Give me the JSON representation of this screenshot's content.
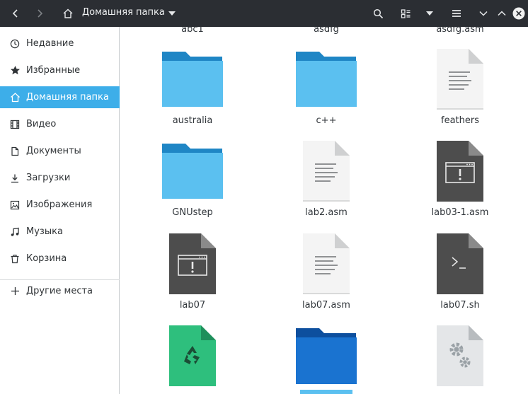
{
  "header": {
    "back_icon": "chevron-left-icon",
    "forward_icon": "chevron-right-icon",
    "home_icon": "home-icon",
    "path_title": "Домашняя папка",
    "path_dropdown_icon": "caret-down-icon",
    "search_icon": "search-icon",
    "view_icon": "view-mode-icon",
    "view_dropdown_icon": "caret-down-icon",
    "menu_icon": "hamburger-menu-icon",
    "minimize_icon": "minimize-icon",
    "maximize_icon": "maximize-icon",
    "close_icon": "close-icon"
  },
  "sidebar": {
    "items": [
      {
        "label": "Недавние",
        "icon": "clock-icon"
      },
      {
        "label": "Избранные",
        "icon": "star-icon"
      },
      {
        "label": "Домашняя папка",
        "icon": "home-icon"
      },
      {
        "label": "Видео",
        "icon": "film-icon"
      },
      {
        "label": "Документы",
        "icon": "document-icon"
      },
      {
        "label": "Загрузки",
        "icon": "download-icon"
      },
      {
        "label": "Изображения",
        "icon": "image-icon"
      },
      {
        "label": "Музыка",
        "icon": "music-icon"
      },
      {
        "label": "Корзина",
        "icon": "trash-icon"
      }
    ],
    "other_places": {
      "label": "Другие места",
      "icon": "plus-icon"
    }
  },
  "files": {
    "cut_row": [
      "abc1",
      "asdfg",
      "asdfg.asm"
    ],
    "rows": [
      [
        {
          "name": "australia",
          "type": "folder"
        },
        {
          "name": "c++",
          "type": "folder"
        },
        {
          "name": "feathers",
          "type": "text"
        }
      ],
      [
        {
          "name": "GNUstep",
          "type": "folder"
        },
        {
          "name": "lab2.asm",
          "type": "text"
        },
        {
          "name": "lab03-1.asm",
          "type": "executable"
        }
      ],
      [
        {
          "name": "lab07",
          "type": "executable"
        },
        {
          "name": "lab07.asm",
          "type": "text"
        },
        {
          "name": "lab07.sh",
          "type": "script"
        }
      ],
      [
        {
          "name": "",
          "type": "recycle"
        },
        {
          "name": "",
          "type": "folder-dark"
        },
        {
          "name": "",
          "type": "settings"
        }
      ]
    ]
  },
  "colors": {
    "header_bg": "#2b2e33",
    "accent": "#3daee9",
    "folder_light": "#5bc0f0",
    "folder_tab": "#1f86c5",
    "folder_dark": "#1a73d0"
  }
}
